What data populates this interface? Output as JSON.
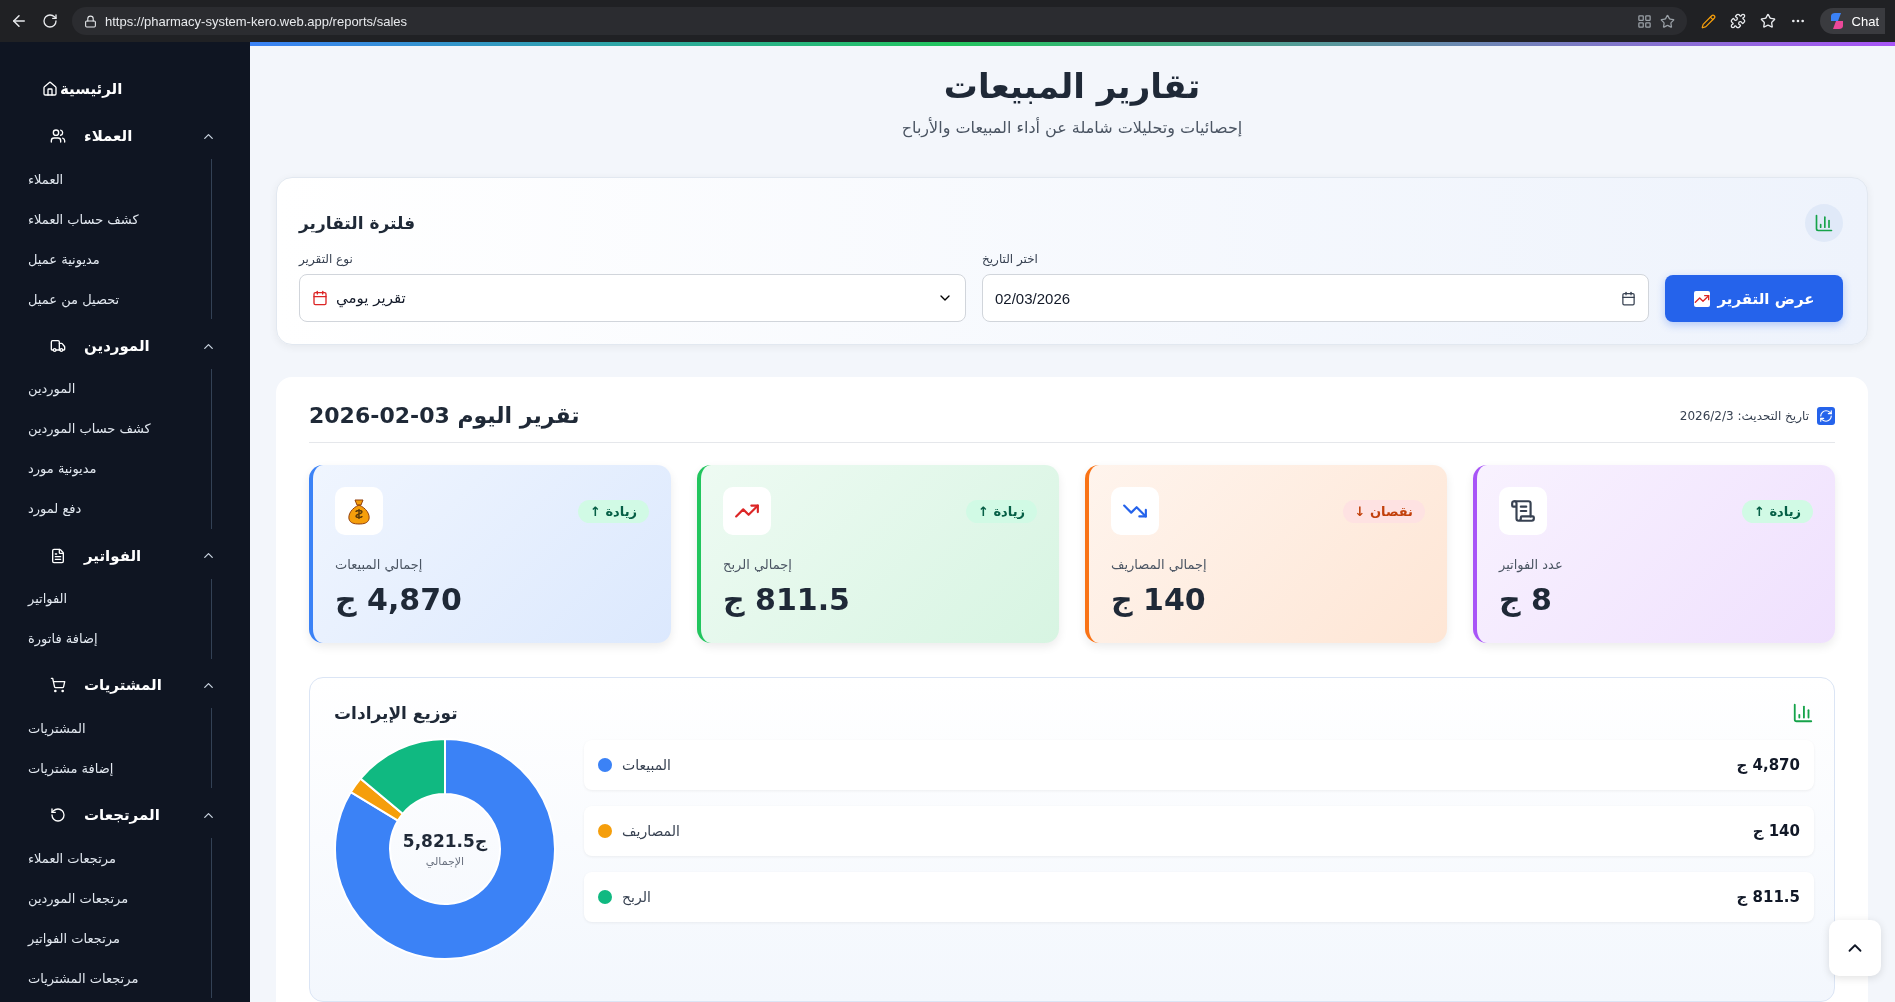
{
  "browser": {
    "url": "https://pharmacy-system-kero.web.app/reports/sales",
    "copilot_label": "Chat"
  },
  "sidebar": {
    "home": "الرئيسية",
    "groups": [
      {
        "label": "العملاء",
        "expanded": true,
        "items": [
          "العملاء",
          "كشف حساب العملاء",
          "مديونية عميل",
          "تحصيل من عميل"
        ]
      },
      {
        "label": "الموردين",
        "expanded": true,
        "items": [
          "الموردين",
          "كشف حساب الموردين",
          "مديونية مورد",
          "دفع لمورد"
        ]
      },
      {
        "label": "الفواتير",
        "expanded": true,
        "items": [
          "الفواتير",
          "إضافة فاتورة"
        ]
      },
      {
        "label": "المشتريات",
        "expanded": true,
        "items": [
          "المشتريات",
          "إضافة مشتريات"
        ]
      },
      {
        "label": "المرتجعات",
        "expanded": true,
        "items": [
          "مرتجعات العملاء",
          "مرتجعات الموردين",
          "مرتجعات الفواتير",
          "مرتجعات المشتريات"
        ]
      }
    ]
  },
  "page": {
    "title": "تقارير المبيعات",
    "subtitle": "إحصائيات وتحليلات شاملة عن أداء المبيعات والأرباح"
  },
  "filter": {
    "title": "فلترة التقارير",
    "type_label": "نوع التقرير",
    "type_value": "تقرير يومي",
    "date_label": "اختر التاريخ",
    "date_value": "02/03/2026",
    "button": "عرض التقرير"
  },
  "report": {
    "title": "تقرير اليوم 03-02-2026",
    "updated": "تاريخ التحديث: 2026/2/3",
    "stats": [
      {
        "label": "عدد الفواتير",
        "value": "8 ج",
        "badge": "زيادة ↑",
        "kind": "increase",
        "color": "#a855f7"
      },
      {
        "label": "إجمالي المصاريف",
        "value": "140 ج",
        "badge": "نقصان ↓",
        "kind": "decrease",
        "color": "#f97316"
      },
      {
        "label": "إجمالي الربح",
        "value": "811.5 ج",
        "badge": "زيادة ↑",
        "kind": "increase",
        "color": "#22c55e"
      },
      {
        "label": "إجمالي المبيعات",
        "value": "4,870 ج",
        "badge": "زيادة ↑",
        "kind": "increase",
        "color": "#3b82f6"
      }
    ],
    "revenue": {
      "title": "توزيع الإيرادات",
      "center_value": "ج5,821.5",
      "center_label": "الإجمالي",
      "legend": [
        {
          "value": "4,870 ج",
          "color": "#3b82f6"
        },
        {
          "value": "140 ج",
          "color": "#f59e0b"
        },
        {
          "value": "811.5 ج",
          "color": "#10b981"
        }
      ],
      "chart_data": {
        "type": "donut",
        "categories": [
          "المبيعات",
          "المصاريف",
          "الربح"
        ],
        "values": [
          83.66,
          2.4,
          13.94
        ]
      }
    }
  }
}
